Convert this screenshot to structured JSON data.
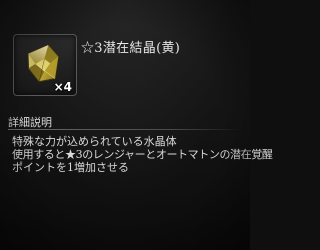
{
  "item": {
    "name": "☆3潜在結晶(黄)",
    "count": "×4",
    "icon": "yellow-crystal-icon"
  },
  "details": {
    "heading": "詳細説明",
    "lines": [
      "特殊な力が込められている水晶体",
      "使用すると★3のレンジャーとオートマトンの潜在覚醒",
      "ポイントを1増加させる"
    ]
  },
  "colors": {
    "background": "#121212",
    "crystal": "#c9b23a",
    "text": "#e6e6e6"
  }
}
